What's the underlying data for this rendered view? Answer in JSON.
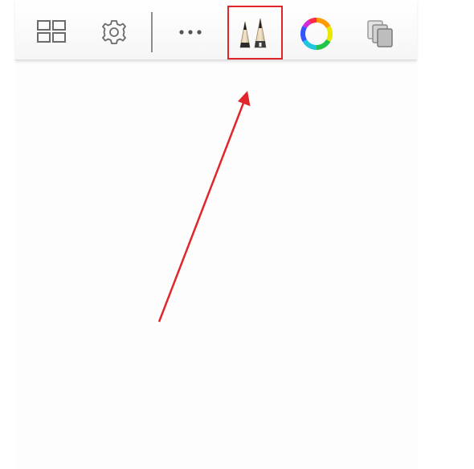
{
  "toolbar": {
    "items": [
      {
        "icon": "gallery-grid-icon",
        "role": "gallery"
      },
      {
        "icon": "gear-icon",
        "role": "settings"
      },
      {
        "icon": "more-dots-icon",
        "role": "more-actions"
      },
      {
        "icon": "brush-library-icon",
        "role": "brushes",
        "highlighted": true
      },
      {
        "icon": "color-wheel-icon",
        "role": "colors"
      },
      {
        "icon": "layers-icon",
        "role": "layers"
      }
    ]
  },
  "annotation": {
    "color": "#e0262b",
    "target": "brush-library-button"
  },
  "colors": {
    "toolbar_bg": "#f6f6f6",
    "icon_gray": "#6b6b6b",
    "canvas_bg": "#fdfdfd"
  }
}
